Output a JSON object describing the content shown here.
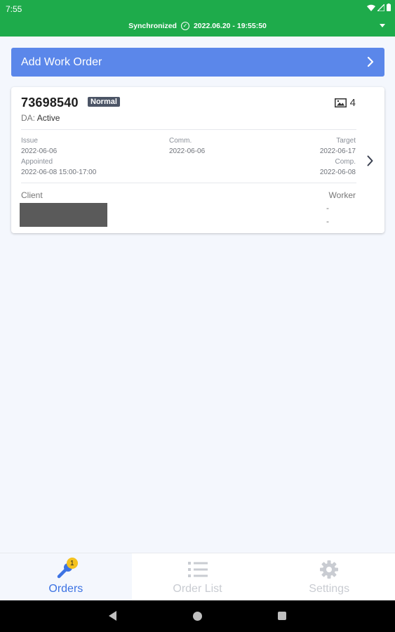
{
  "status_bar": {
    "time": "7:55"
  },
  "sync": {
    "status": "Synchronized",
    "timestamp": "2022.06.20 - 19:55:50"
  },
  "add_button": {
    "label": "Add Work Order"
  },
  "order_card": {
    "order_number": "73698540",
    "priority_badge": "Normal",
    "photo_count": "4",
    "da_label": "DA:",
    "da_value": "Active",
    "issue_label": "Issue",
    "issue_date": "2022-06-06",
    "comm_label": "Comm.",
    "comm_date": "2022-06-06",
    "target_label": "Target",
    "target_date": "2022-06-17",
    "appointed_label": "Appointed",
    "appointed_value": "2022-06-08 15:00-17:00",
    "comp_label": "Comp.",
    "comp_date": "2022-06-08",
    "client_label": "Client",
    "worker_label": "Worker",
    "worker_values": [
      "-",
      "-"
    ]
  },
  "bottom_nav": {
    "items": [
      {
        "label": "Orders",
        "icon": "wrench-icon",
        "badge": "1",
        "active": true
      },
      {
        "label": "Order List",
        "icon": "list-icon",
        "active": false
      },
      {
        "label": "Settings",
        "icon": "gear-icon",
        "active": false
      }
    ]
  },
  "colors": {
    "sync_bar": "#1eab4b",
    "primary_button": "#5b87ea",
    "active_tab": "#3d73e3",
    "badge": "#f4c21f",
    "priority_badge": "#4c5566"
  }
}
